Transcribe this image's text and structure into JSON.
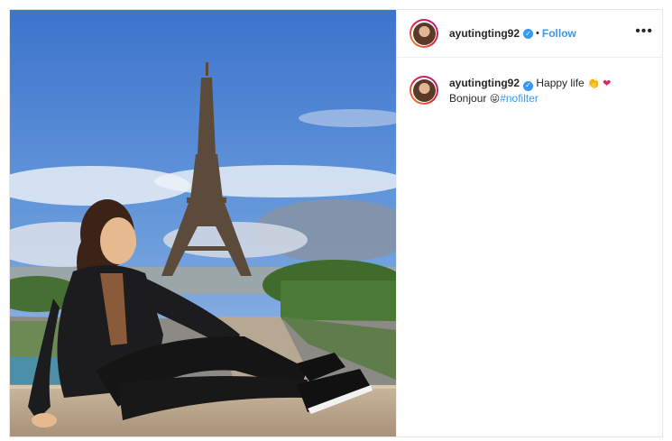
{
  "post": {
    "author": {
      "username": "ayutingting92",
      "verified_icon": "verified-badge-icon",
      "dot": "•",
      "follow_label": "Follow"
    },
    "more_icon": "more-options-icon",
    "more_glyph": "•••",
    "caption": {
      "username": "ayutingting92",
      "text_before": "Happy life",
      "emoji_1": "👏",
      "emoji_2": "❤",
      "line2_text": "Bonjour",
      "emoji_3": "😜",
      "hashtag": "#nofilter"
    },
    "colors": {
      "accent": "#3897f0",
      "sky": "#4f84d2",
      "border": "#e6e6e6"
    }
  }
}
